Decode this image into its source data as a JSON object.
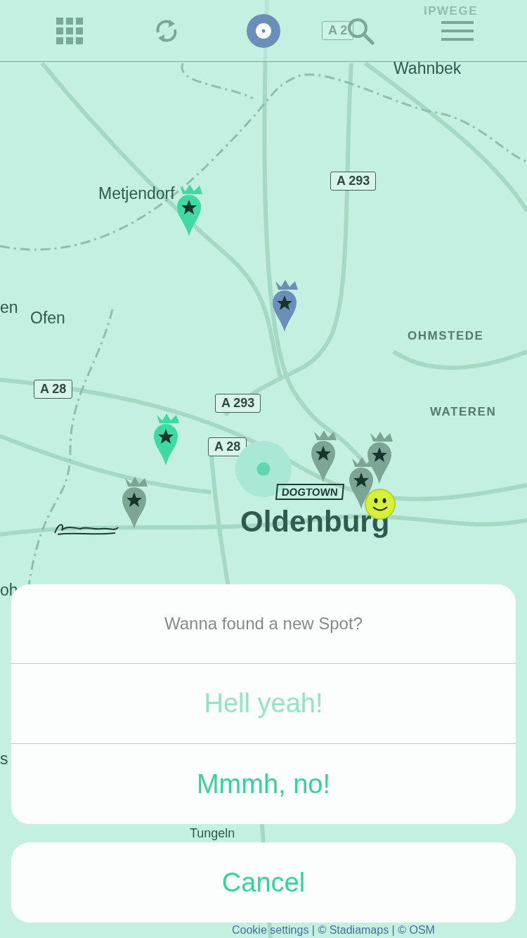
{
  "toolbar": [
    {
      "kind": "grid"
    },
    {
      "kind": "refresh"
    },
    {
      "kind": "locate"
    },
    {
      "kind": "search"
    },
    {
      "kind": "menu"
    }
  ],
  "map": {
    "labels": [
      {
        "text": "IPWEGE",
        "kind": "district"
      },
      {
        "text": "Wahnbek",
        "kind": "place"
      },
      {
        "text": "Metjendorf",
        "kind": "place"
      },
      {
        "text": "en",
        "kind": "place"
      },
      {
        "text": "Ofen",
        "kind": "place"
      },
      {
        "text": "OHMSTEDE",
        "kind": "district"
      },
      {
        "text": "WATEREN",
        "kind": "district"
      },
      {
        "text": "Oldenburg",
        "kind": "city"
      },
      {
        "text": "oh",
        "kind": "place"
      },
      {
        "text": "s",
        "kind": "place"
      },
      {
        "text": "Tungeln",
        "kind": "place"
      }
    ],
    "shields": [
      "A 2",
      "A 293",
      "A 28",
      "A 293",
      "A 28"
    ],
    "pins": [
      {
        "color": "#3fd9a4"
      },
      {
        "color": "#6a8fb8"
      },
      {
        "color": "#3fd9a4"
      },
      {
        "color": "#7da596"
      },
      {
        "color": "#7da596"
      },
      {
        "color": "#7da596"
      },
      {
        "color": "#7da596"
      }
    ],
    "sticker": "DOGTOWN",
    "attribution": "Cookie settings | © Stadiamaps | © OSM"
  },
  "sheet": {
    "title": "Wanna found a new Spot?",
    "actions": [
      {
        "label": "Hell yeah!",
        "disabled": true
      },
      {
        "label": "Mmmh, no!",
        "disabled": false
      }
    ],
    "cancel": "Cancel"
  }
}
